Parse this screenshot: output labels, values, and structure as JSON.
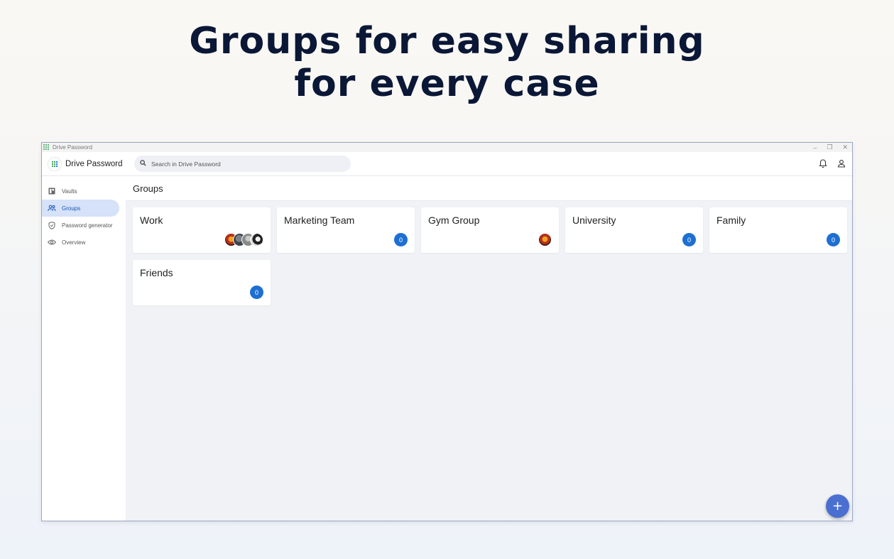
{
  "hero": {
    "line1": "Groups for easy sharing",
    "line2": "for every case"
  },
  "window": {
    "title": "Drive Password",
    "controls": {
      "minimize": "–",
      "restore": "❐",
      "close": "✕"
    }
  },
  "appbar": {
    "brand_name": "Drive Password",
    "search_placeholder": "Search in Drive Password",
    "icons": [
      "bell-icon",
      "user-icon"
    ]
  },
  "sidebar": {
    "items": [
      {
        "label": "Vaults",
        "icon": "vault-icon",
        "active": false
      },
      {
        "label": "Groups",
        "icon": "groups-icon",
        "active": true
      },
      {
        "label": "Password generator",
        "icon": "shield-icon",
        "active": false
      },
      {
        "label": "Overview",
        "icon": "eye-icon",
        "active": false
      }
    ]
  },
  "main": {
    "title": "Groups",
    "groups": [
      {
        "name": "Work",
        "members": "avatars",
        "avatar_count": 4
      },
      {
        "name": "Marketing Team",
        "count": "0"
      },
      {
        "name": "Gym Group",
        "members": "avatars",
        "avatar_count": 1
      },
      {
        "name": "University",
        "count": "0"
      },
      {
        "name": "Family",
        "count": "0"
      },
      {
        "name": "Friends",
        "count": "0"
      }
    ],
    "fab_label": "+"
  },
  "colors": {
    "accent": "#1d6fd2",
    "fab": "#4a6fd0",
    "active_nav_bg": "#d5e2f8",
    "hero_text": "#0b1736"
  }
}
